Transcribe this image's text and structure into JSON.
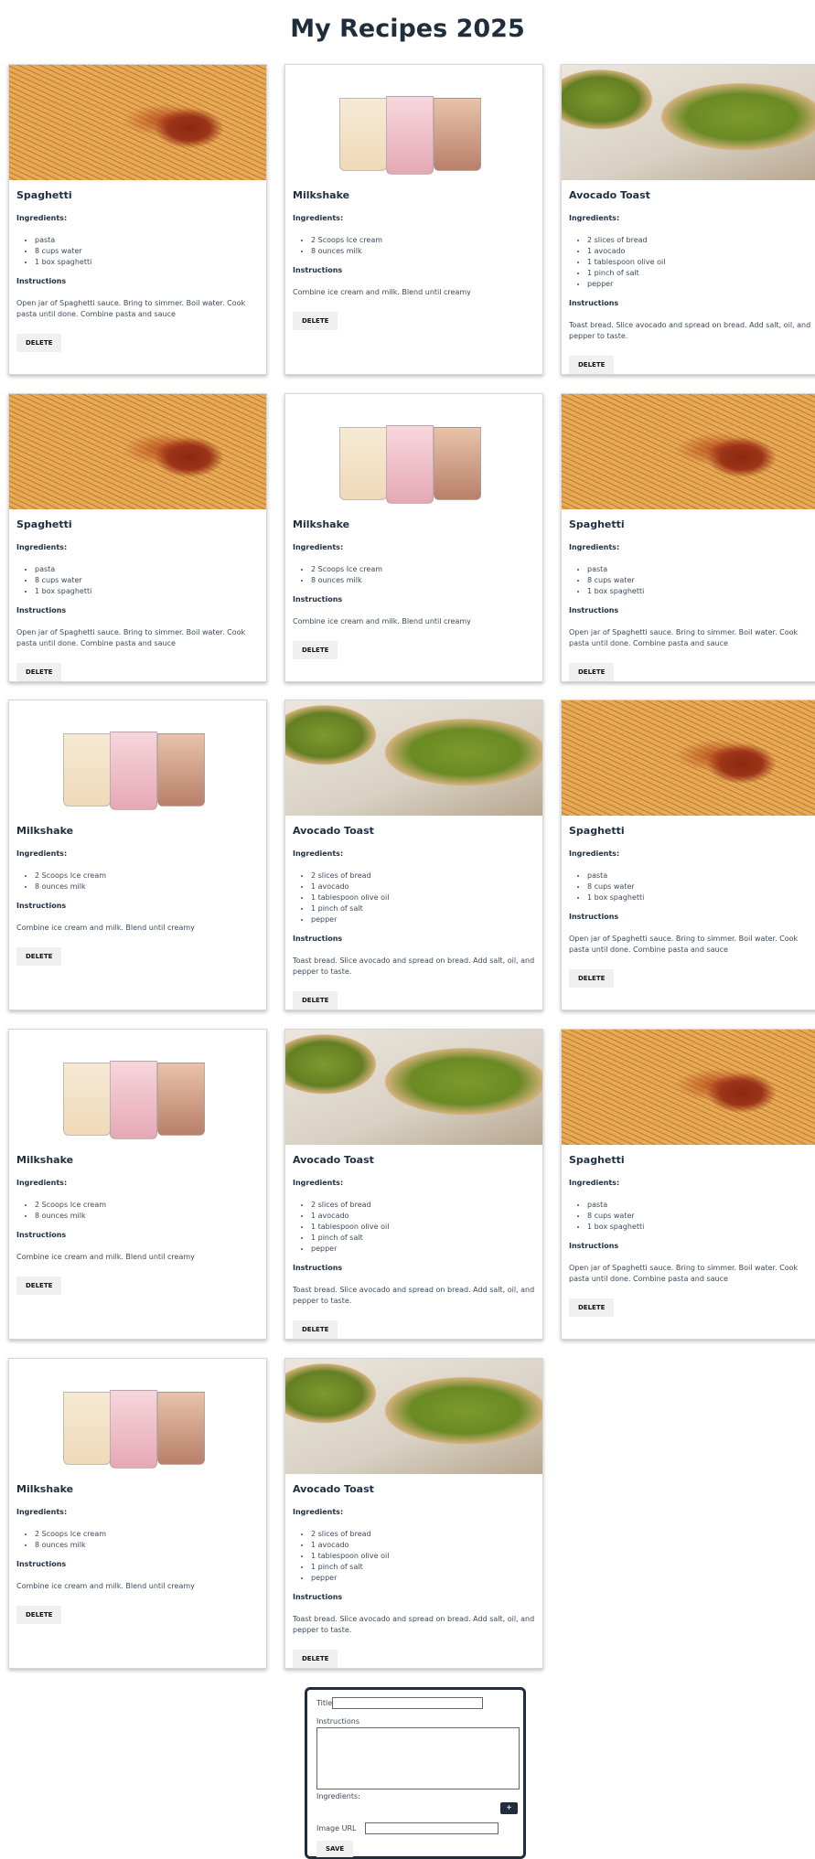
{
  "page_title": "My Recipes 2025",
  "recipes": {
    "spaghetti": {
      "title": "Spaghetti",
      "ingredients_label": "Ingredients:",
      "ingredients": [
        "pasta",
        "8 cups water",
        "1 box spaghetti"
      ],
      "instructions_label": "Instructions",
      "instructions": "Open jar of Spaghetti sauce. Bring to simmer. Boil water. Cook pasta until done. Combine pasta and sauce",
      "delete_label": "DELETE"
    },
    "milkshake": {
      "title": "Milkshake",
      "ingredients_label": "Ingredients:",
      "ingredients": [
        "2 Scoops Ice cream",
        "8 ounces milk"
      ],
      "instructions_label": "Instructions",
      "instructions": "Combine ice cream and milk. Blend until creamy",
      "delete_label": "DELETE"
    },
    "avocado": {
      "title": "Avocado Toast",
      "ingredients_label": "Ingredients:",
      "ingredients": [
        "2 slices of bread",
        "1 avocado",
        "1 tablespoon olive oil",
        "1 pinch of salt",
        "pepper"
      ],
      "instructions_label": "Instructions",
      "instructions": "Toast bread. Slice avocado and spread on bread. Add salt, oil, and pepper to taste.",
      "delete_label": "DELETE"
    }
  },
  "card_sequence": [
    "spaghetti",
    "milkshake",
    "avocado",
    "spaghetti",
    "milkshake",
    "spaghetti",
    "milkshake",
    "avocado",
    "spaghetti",
    "milkshake",
    "avocado",
    "spaghetti",
    "milkshake",
    "avocado"
  ],
  "form": {
    "title_label": "Title",
    "title_value": "",
    "instructions_label": "Instructions",
    "instructions_value": "",
    "ingredients_label": "Ingredients:",
    "add_ingredient_label": "+",
    "image_url_label": "Image URL",
    "image_url_value": "",
    "save_label": "SAVE"
  },
  "colors": {
    "heading": "#1f2d3d",
    "text": "#3b4a5a",
    "button_bg": "#f0f0f0",
    "accent": "#1f2d3d"
  }
}
